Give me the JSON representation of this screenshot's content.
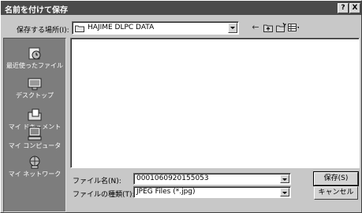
{
  "dialog": {
    "title": "名前を付けて保存",
    "help_label": "?",
    "close_label": "X"
  },
  "location": {
    "label": "保存する場所(I):",
    "value": "HAJIME DLPC DATA"
  },
  "places": [
    {
      "label": "最近使ったファイル",
      "icon": "recent-files-icon"
    },
    {
      "label": "デスクトップ",
      "icon": "desktop-icon"
    },
    {
      "label": "マイ ドキュメント",
      "icon": "my-documents-icon"
    },
    {
      "label": "マイ コンピュータ",
      "icon": "my-computer-icon"
    },
    {
      "label": "マイ ネットワーク",
      "icon": "my-network-icon"
    }
  ],
  "filename": {
    "label": "ファイル名(N):",
    "value": "0001060920155053"
  },
  "filetype": {
    "label": "ファイルの種類(T):",
    "value": "JPEG Files (*.jpg)"
  },
  "buttons": {
    "save": "保存(S)",
    "cancel": "キャンセル"
  },
  "colors": {
    "titlebar": "#4b4b4b",
    "dialog_bg": "#c8c8c8",
    "places_bg": "#7d7d7d"
  }
}
